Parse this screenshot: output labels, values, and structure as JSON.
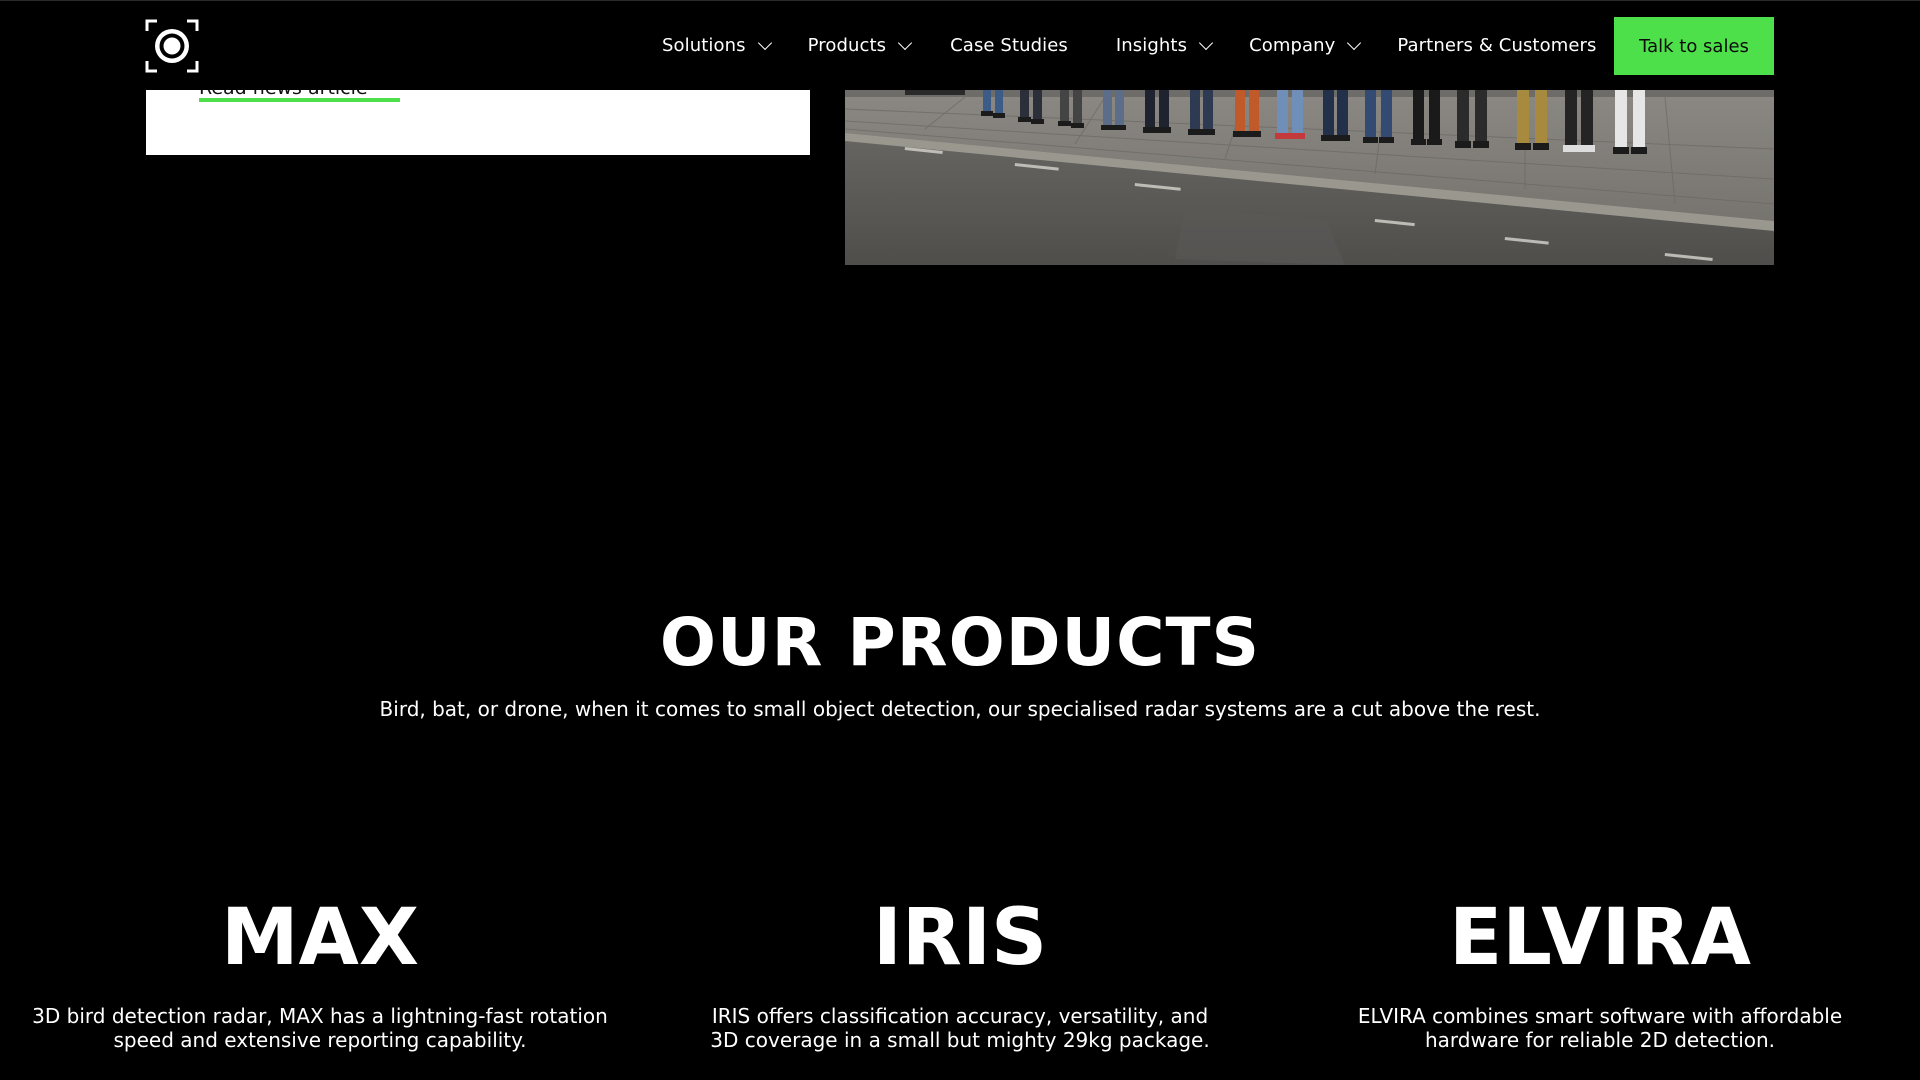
{
  "nav": {
    "logo": "logo-icon",
    "items": [
      {
        "label": "Solutions",
        "has_dropdown": true
      },
      {
        "label": "Products",
        "has_dropdown": true
      },
      {
        "label": "Case Studies",
        "has_dropdown": false
      },
      {
        "label": "Insights",
        "has_dropdown": true
      },
      {
        "label": "Company",
        "has_dropdown": true
      },
      {
        "label": "Partners & Customers",
        "has_dropdown": false
      }
    ],
    "cta_label": "Talk to sales"
  },
  "news": {
    "link_label": "Read news article"
  },
  "products_section": {
    "title": "OUR PRODUCTS",
    "subtitle": "Bird, bat, or drone, when it comes to small object detection, our specialised radar systems are a cut above the rest.",
    "items": [
      {
        "name": "MAX",
        "description": "3D bird detection radar, MAX has a lightning-fast rotation speed and extensive reporting capability."
      },
      {
        "name": "IRIS",
        "description": "IRIS offers classification accuracy, versatility, and 3D coverage in a small but mighty 29kg package."
      },
      {
        "name": "ELVIRA",
        "description": "ELVIRA combines smart software with affordable hardware for reliable 2D detection."
      }
    ]
  },
  "colors": {
    "accent": "#4ee04a",
    "background": "#000000",
    "text": "#ffffff"
  }
}
